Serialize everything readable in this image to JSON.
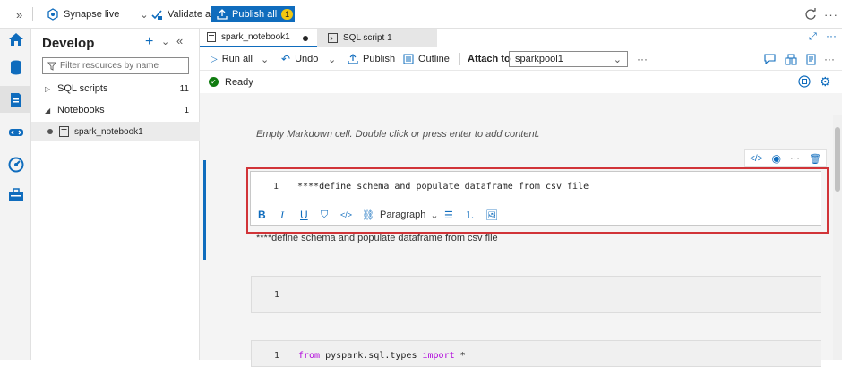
{
  "topbar": {
    "collapse_glyph": "»",
    "workspace_label": "Synapse live",
    "validate_label": "Validate all",
    "publish_label": "Publish all",
    "publish_count": "1"
  },
  "explorer": {
    "title": "Develop",
    "filter_placeholder": "Filter resources by name",
    "groups": [
      {
        "label": "SQL scripts",
        "count": "11"
      },
      {
        "label": "Notebooks",
        "count": "1"
      }
    ],
    "notebook_item": "spark_notebook1"
  },
  "tabs": [
    {
      "label": "spark_notebook1"
    },
    {
      "label": "SQL script 1"
    }
  ],
  "toolbar": {
    "run_all": "Run all",
    "undo": "Undo",
    "publish": "Publish",
    "outline": "Outline",
    "attach_to": "Attach to",
    "pool": "sparkpool1"
  },
  "status": {
    "text": "Ready"
  },
  "notebook": {
    "empty_md_hint": "Empty Markdown cell. Double click or press enter to add content.",
    "md_cell": {
      "line_no": "1",
      "text": "****define schema and populate dataframe from csv file",
      "format_dropdown": "Paragraph"
    },
    "rendered_md": "****define schema and populate dataframe from csv file",
    "code_cell_1": {
      "line_no": "1",
      "text": ""
    },
    "code_cell_2": {
      "line_no": "1",
      "kw_from": "from",
      "module": " pyspark.sql.types ",
      "kw_import": "import",
      "rest": " *"
    }
  },
  "colors": {
    "accent": "#0f6cbd",
    "highlight_box": "#d13438",
    "status_ok": "#107c10"
  }
}
